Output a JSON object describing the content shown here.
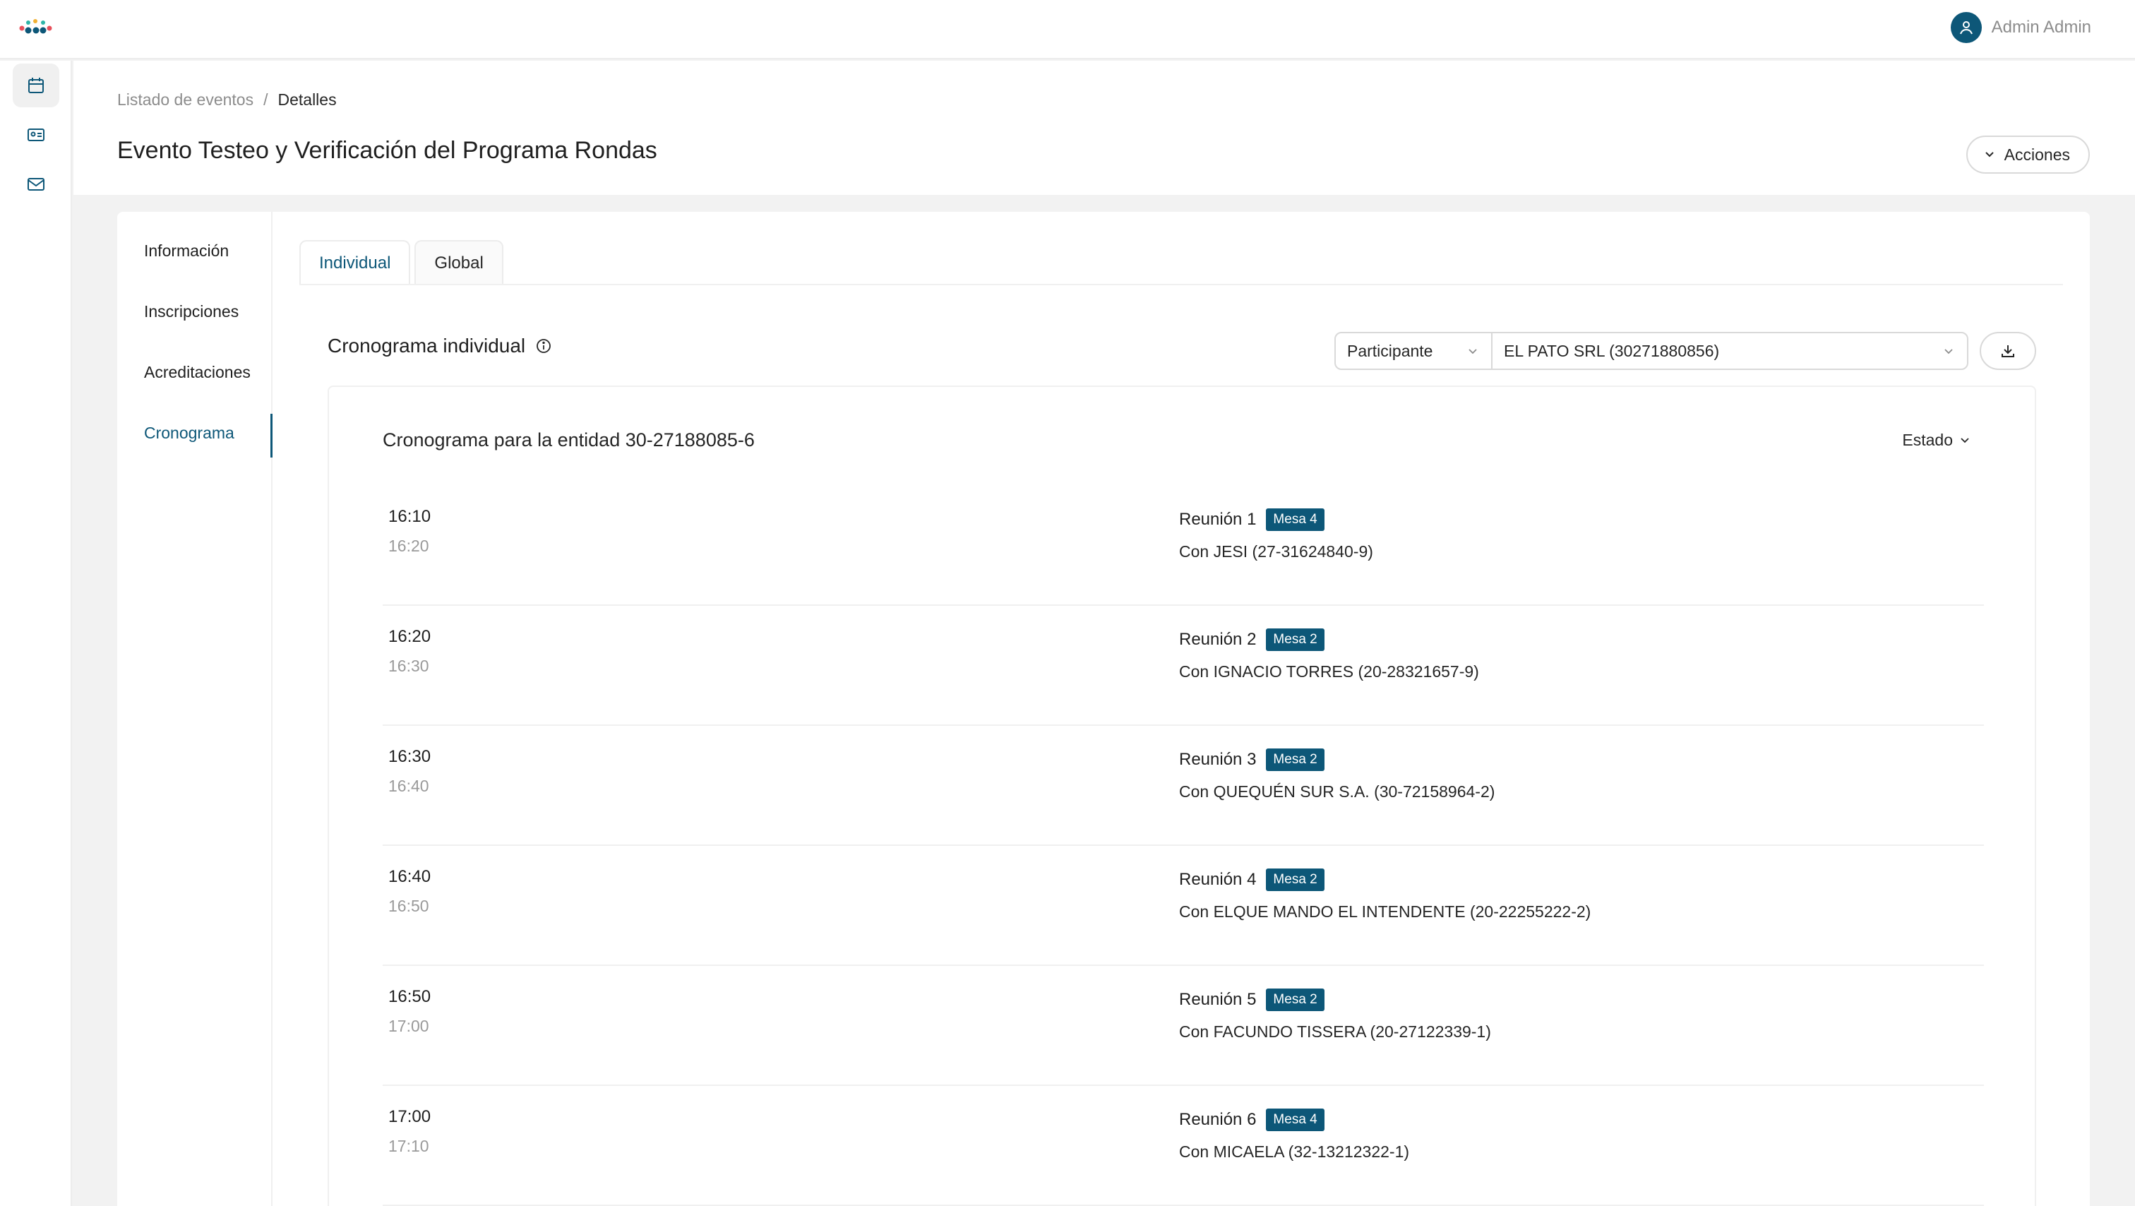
{
  "user": {
    "name": "Admin Admin"
  },
  "icons": {
    "brand": "app-logo",
    "user": "user-icon",
    "nav": [
      "calendar-icon",
      "id-card-icon",
      "mail-icon"
    ]
  },
  "colors": {
    "accent": "#0d5778",
    "muted": "#8c8c8c"
  },
  "breadcrumb": {
    "parent": "Listado de eventos",
    "separator": "/",
    "current": "Detalles"
  },
  "page": {
    "title": "Evento Testeo y Verificación del Programa Rondas"
  },
  "actions": {
    "label": "Acciones"
  },
  "menu": {
    "items": [
      {
        "label": "Información"
      },
      {
        "label": "Inscripciones"
      },
      {
        "label": "Acreditaciones"
      },
      {
        "label": "Cronograma",
        "active": true
      }
    ]
  },
  "tabs": [
    {
      "label": "Individual",
      "active": true
    },
    {
      "label": "Global"
    }
  ],
  "schedule": {
    "title": "Cronograma individual",
    "filter_type": "Participante",
    "filter_value": "EL PATO SRL (30271880856)",
    "entity_title": "Cronograma para la entidad 30-27188085-6",
    "status_filter": "Estado",
    "meetings": [
      {
        "start": "16:10",
        "end": "16:20",
        "title": "Reunión 1",
        "table": "Mesa 4",
        "with": "Con JESI (27-31624840-9)"
      },
      {
        "start": "16:20",
        "end": "16:30",
        "title": "Reunión 2",
        "table": "Mesa 2",
        "with": "Con IGNACIO TORRES (20-28321657-9)"
      },
      {
        "start": "16:30",
        "end": "16:40",
        "title": "Reunión 3",
        "table": "Mesa 2",
        "with": "Con QUEQUÉN SUR S.A. (30-72158964-2)"
      },
      {
        "start": "16:40",
        "end": "16:50",
        "title": "Reunión 4",
        "table": "Mesa 2",
        "with": "Con ELQUE MANDO EL INTENDENTE (20-22255222-2)"
      },
      {
        "start": "16:50",
        "end": "17:00",
        "title": "Reunión 5",
        "table": "Mesa 2",
        "with": "Con FACUNDO TISSERA (20-27122339-1)"
      },
      {
        "start": "17:00",
        "end": "17:10",
        "title": "Reunión 6",
        "table": "Mesa 4",
        "with": "Con MICAELA (32-13212322-1)"
      }
    ]
  }
}
